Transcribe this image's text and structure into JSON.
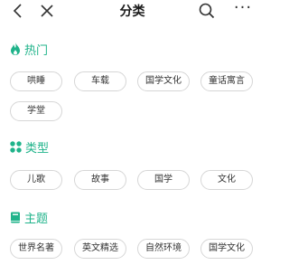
{
  "header": {
    "title": "分类"
  },
  "sections": [
    {
      "title": "热门",
      "icon": "flame-icon",
      "chips": [
        "哄睡",
        "车载",
        "国学文化",
        "童话寓言",
        "学堂"
      ]
    },
    {
      "title": "类型",
      "icon": "grid-dots-icon",
      "chips": [
        "儿歌",
        "故事",
        "国学",
        "文化"
      ]
    },
    {
      "title": "主题",
      "icon": "book-icon",
      "chips": [
        "世界名著",
        "英文精选",
        "自然环境",
        "国学文化"
      ]
    }
  ],
  "colors": {
    "accent": "#1fb38a",
    "chip_border": "#d6d6d6",
    "text": "#333333"
  }
}
